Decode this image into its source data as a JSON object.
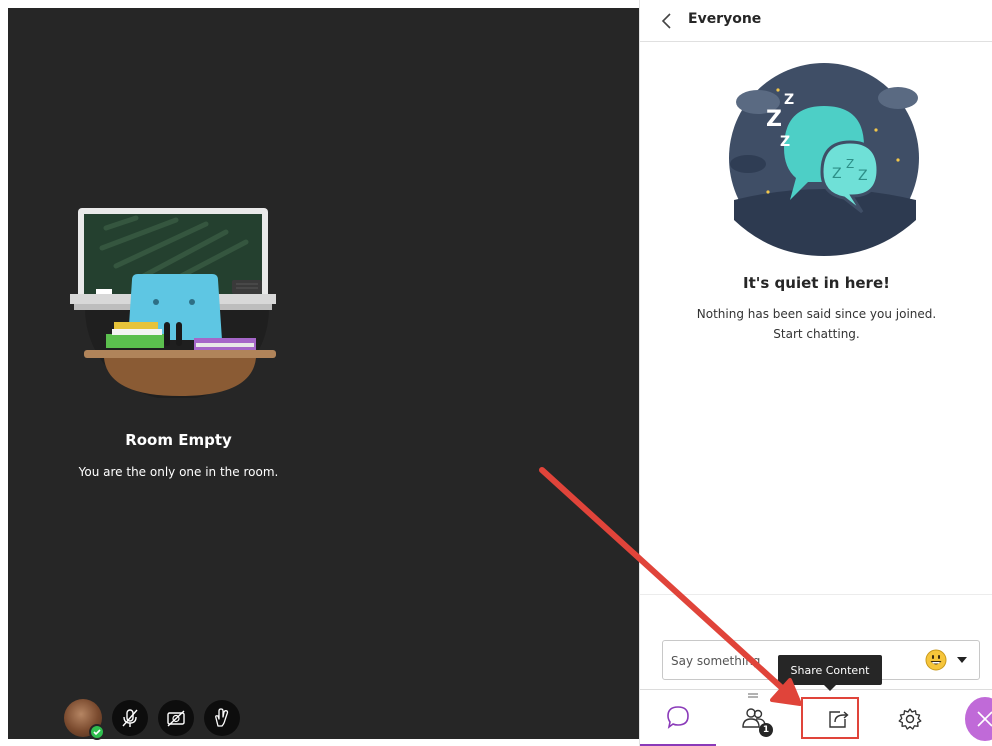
{
  "stage": {
    "room_title": "Room Empty",
    "room_subtitle": "You are the only one in the room."
  },
  "media_controls": [
    {
      "icon": "avatar-icon"
    },
    {
      "icon": "microphone-muted-icon"
    },
    {
      "icon": "camera-off-icon"
    },
    {
      "icon": "raise-hand-icon"
    }
  ],
  "panel": {
    "header_title": "Everyone",
    "empty_title": "It's quiet in here!",
    "empty_line1": "Nothing has been said since you joined.",
    "empty_line2": "Start chatting.",
    "chat_placeholder": "Say something"
  },
  "tooltip": {
    "text": "Share Content"
  },
  "tabs": [
    {
      "name": "chat",
      "icon": "chat-bubble-icon"
    },
    {
      "name": "attendees",
      "icon": "people-icon",
      "badge": "1"
    },
    {
      "name": "share",
      "icon": "share-content-icon"
    },
    {
      "name": "settings",
      "icon": "gear-icon"
    },
    {
      "name": "close",
      "icon": "close-icon"
    }
  ],
  "colors": {
    "stage_bg": "#262626",
    "accent": "#8a3ab9",
    "close_bg": "#c06ad8",
    "annotation_red": "#e0443a",
    "bubble_teal": "#3fcdc4"
  }
}
